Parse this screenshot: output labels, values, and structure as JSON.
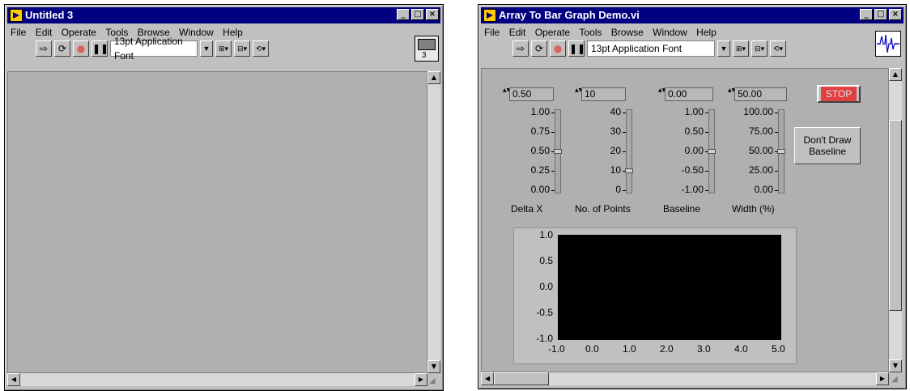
{
  "window1": {
    "title": "Untitled 3",
    "menu": [
      "File",
      "Edit",
      "Operate",
      "Tools",
      "Browse",
      "Window",
      "Help"
    ],
    "font": "13pt Application Font",
    "badge": "3"
  },
  "window2": {
    "title": "Array To Bar Graph Demo.vi",
    "menu": [
      "File",
      "Edit",
      "Operate",
      "Tools",
      "Browse",
      "Window",
      "Help"
    ],
    "font": "13pt Application Font",
    "controls": [
      {
        "value": "0.50",
        "label": "Delta X",
        "ticks": [
          "1.00",
          "0.75",
          "0.50",
          "0.25",
          "0.00"
        ],
        "level": 0.5
      },
      {
        "value": "10",
        "label": "No. of Points",
        "ticks": [
          "40",
          "30",
          "20",
          "10",
          "0"
        ],
        "level": 0.25
      },
      {
        "value": "0.00",
        "label": "Baseline",
        "ticks": [
          "1.00",
          "0.50",
          "0.00",
          "-0.50",
          "-1.00"
        ],
        "level": 0.5
      },
      {
        "value": "50.00",
        "label": "Width (%)",
        "ticks": [
          "100.00",
          "75.00",
          "50.00",
          "25.00",
          "0.00"
        ],
        "level": 0.5
      }
    ],
    "stop_label": "STOP",
    "baseline_btn": "Don't Draw Baseline",
    "graph": {
      "y_ticks": [
        "1.0",
        "0.5",
        "0.0",
        "-0.5",
        "-1.0"
      ],
      "x_ticks": [
        "-1.0",
        "0.0",
        "1.0",
        "2.0",
        "3.0",
        "4.0",
        "5.0"
      ]
    }
  }
}
